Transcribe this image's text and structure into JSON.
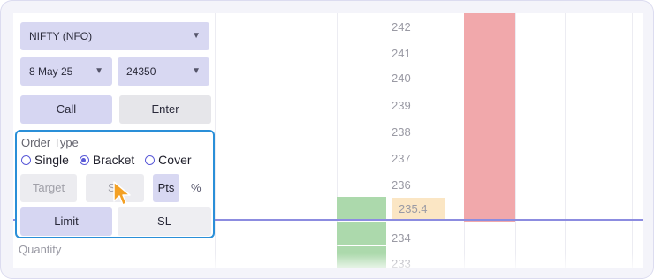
{
  "instrument_select": {
    "value": "NIFTY (NFO)"
  },
  "expiry_select": {
    "value": "8 May 25"
  },
  "strike_select": {
    "value": "24350"
  },
  "call_button": {
    "label": "Call"
  },
  "enter_button": {
    "label": "Enter"
  },
  "order_type": {
    "title": "Order Type",
    "options": [
      {
        "label": "Single",
        "selected": false
      },
      {
        "label": "Bracket",
        "selected": true
      },
      {
        "label": "Cover",
        "selected": false
      }
    ],
    "target_label": "Target",
    "sl_label": "SL",
    "pts_label": "Pts",
    "pct_label": "%",
    "limit_label": "Limit",
    "sl_type_label": "SL"
  },
  "quantity_label": "Quantity",
  "ladder": {
    "prices": [
      "242",
      "241",
      "240",
      "239",
      "238",
      "237",
      "236",
      "235.4",
      "234",
      "233"
    ],
    "current_price": "235.4"
  },
  "colors": {
    "sell_bar": "#f1a8ab",
    "buy_bar": "#acd9ac",
    "ltp_line": "#8c8ce0",
    "accent": "#2a8fd8"
  }
}
